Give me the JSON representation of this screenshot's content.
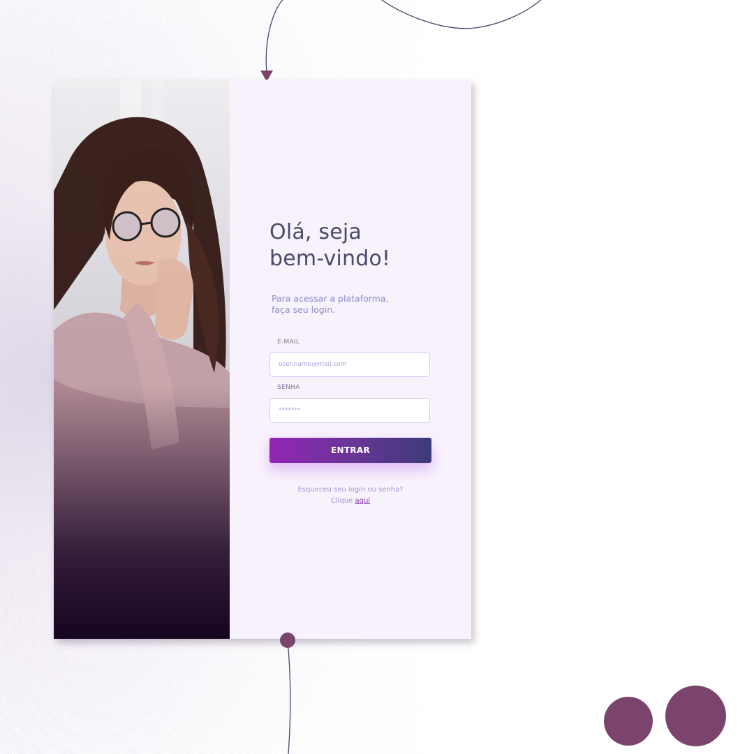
{
  "login": {
    "title_line1": "Olá, seja",
    "title_line2": "bem-vindo!",
    "subtitle_line1": "Para acessar a plataforma,",
    "subtitle_line2": "faça seu login.",
    "email_label": "E-MAIL",
    "email_placeholder": "user.name@mail.com",
    "password_label": "SENHA",
    "password_placeholder": "*******",
    "submit_label": "ENTRAR",
    "forgot_text": "Esqueceu seu login ou senha?",
    "click_text": "Clique",
    "here_link": "aqui"
  },
  "colors": {
    "accent": "#7a446d",
    "button_start": "#9326b5",
    "button_end": "#3d3b78",
    "form_bg": "#f8f2fc",
    "title": "#4a4a6a",
    "subtitle": "#8a8ac8",
    "link": "#8c3aa8"
  },
  "photo": {
    "description_icon": "woman-portrait-photo"
  }
}
